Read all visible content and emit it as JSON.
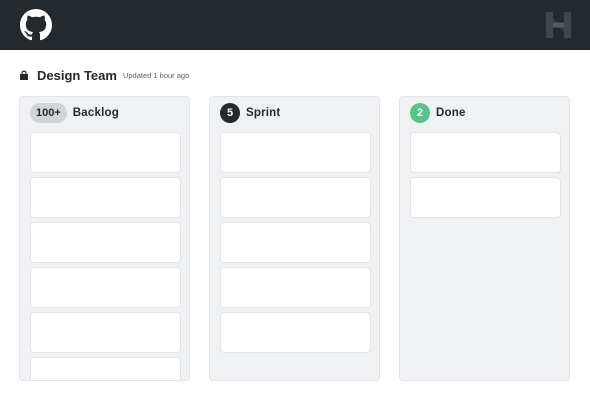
{
  "topbar": {
    "background": "#24292e",
    "left_icon": "github-octocat-icon",
    "right_icon": "brand-h-logo-icon"
  },
  "board": {
    "title": "Design Team",
    "updated": "Updated 1 hour ago",
    "privacy_icon": "lock-icon"
  },
  "columns": [
    {
      "title": "Backlog",
      "count": "100+",
      "badge_bg": "#d1d5da",
      "badge_fg": "#24292e",
      "cards_visible": 6
    },
    {
      "title": "Sprint",
      "count": "5",
      "badge_bg": "#24292e",
      "badge_fg": "#ffffff",
      "cards_visible": 5
    },
    {
      "title": "Done",
      "count": "2",
      "badge_bg": "#56c38a",
      "badge_fg": "#ffffff",
      "cards_visible": 2
    }
  ]
}
